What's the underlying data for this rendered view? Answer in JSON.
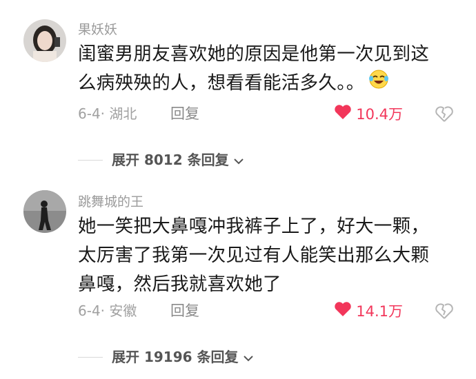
{
  "comments": [
    {
      "username": "果妖妖",
      "text_lines": [
        "闺蜜男朋友喜欢她的原因是他第一次见到这",
        "么病殃殃的人，想看看能活多久。。"
      ],
      "emoji": "laughing-tears-emoji",
      "date_location": "6-4· 湖北",
      "reply_label": "回复",
      "likes": "10.4万",
      "expand_label": "展开 8012 条回复"
    },
    {
      "username": "跳舞城的王",
      "text_lines": [
        "她一笑把大鼻嘎冲我裤子上了，好大一颗，",
        "太厉害了我第一次见过有人能笑出那么大颗",
        "鼻嘎，然后我就喜欢她了"
      ],
      "date_location": "6-4· 安徽",
      "reply_label": "回复",
      "likes": "14.1万",
      "expand_label": "展开 19196 条回复"
    }
  ],
  "colors": {
    "like_red": "#f2365a",
    "meta_gray": "#a0a0a0",
    "text": "#1a1a1a"
  },
  "icons": [
    "heart-icon",
    "broken-heart-icon",
    "chevron-down-icon"
  ]
}
